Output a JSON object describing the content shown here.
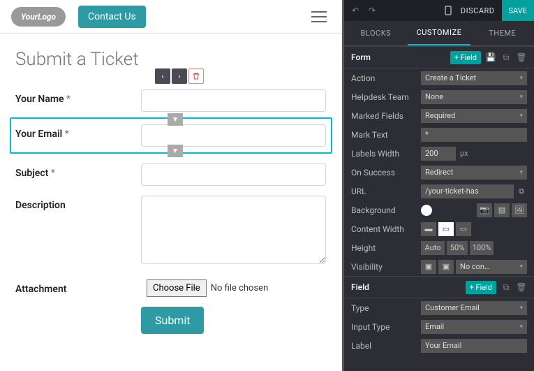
{
  "header": {
    "logo_text": "YourLogo",
    "contact_label": "Contact Us"
  },
  "page": {
    "title": "Submit a Ticket",
    "fields": {
      "name_label": "Your Name",
      "email_label": "Your Email",
      "subject_label": "Subject",
      "description_label": "Description",
      "attachment_label": "Attachment",
      "req_mark": "*",
      "choose_file": "Choose File",
      "no_file": "No file chosen",
      "submit": "Submit"
    }
  },
  "panel": {
    "top": {
      "discard": "DISCARD",
      "save": "SAVE"
    },
    "tabs": {
      "blocks": "BLOCKS",
      "customize": "CUSTOMIZE",
      "theme": "THEME"
    },
    "form_section": {
      "title": "Form",
      "add_field": "+ Field",
      "action_label": "Action",
      "action_value": "Create a Ticket",
      "helpdesk_label": "Helpdesk Team",
      "helpdesk_value": "None",
      "marked_label": "Marked Fields",
      "marked_value": "Required",
      "marktext_label": "Mark Text",
      "marktext_value": "*",
      "labelswidth_label": "Labels Width",
      "labelswidth_value": "200",
      "labelswidth_unit": "px",
      "onsuccess_label": "On Success",
      "onsuccess_value": "Redirect",
      "url_label": "URL",
      "url_value": "/your-ticket-has",
      "background_label": "Background",
      "contentwidth_label": "Content Width",
      "height_label": "Height",
      "height_auto": "Auto",
      "height_50": "50%",
      "height_100": "100%",
      "visibility_label": "Visibility",
      "visibility_value": "No con…"
    },
    "field_section": {
      "title": "Field",
      "add_field": "+ Field",
      "type_label": "Type",
      "type_value": "Customer Email",
      "inputtype_label": "Input Type",
      "inputtype_value": "Email",
      "label_label": "Label",
      "label_value": "Your Email"
    }
  }
}
